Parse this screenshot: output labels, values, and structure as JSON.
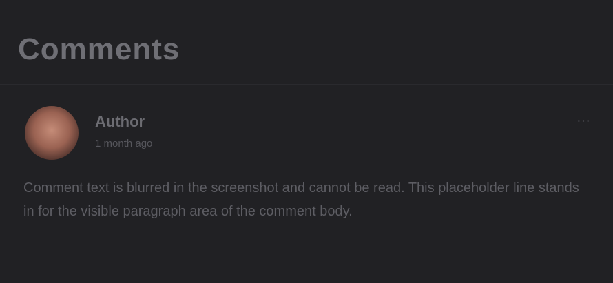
{
  "section": {
    "title": "Comments"
  },
  "comment": {
    "author": "Author",
    "meta": "1 month ago",
    "more_icon": "more-icon",
    "body": "Comment text is blurred in the screenshot and cannot be read. This placeholder line stands in for the visible paragraph area of the comment body."
  }
}
